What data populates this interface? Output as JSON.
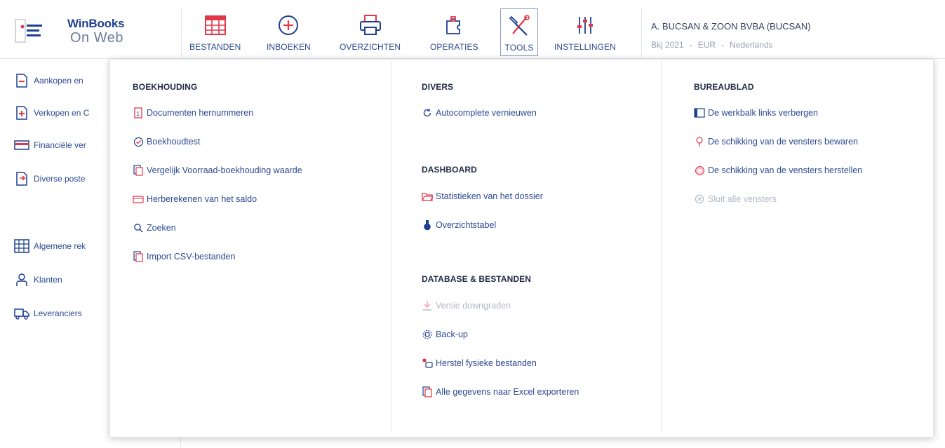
{
  "logo": {
    "name": "WinBooks",
    "sub": "On Web",
    "icon": "winbooks-logo-icon"
  },
  "menu": [
    {
      "label": "BESTANDEN",
      "icon": "grid-table-icon"
    },
    {
      "label": "INBOEKEN",
      "icon": "plus-circle-icon"
    },
    {
      "label": "OVERZICHTEN",
      "icon": "printer-icon"
    },
    {
      "label": "OPERATIES",
      "icon": "puzzle-icon"
    },
    {
      "label": "TOOLS",
      "icon": "tools-icon",
      "active": true
    },
    {
      "label": "INSTELLINGEN",
      "icon": "sliders-icon"
    }
  ],
  "dossier": {
    "name": "A. BUCSAN & ZOON BVBA (BUCSAN)",
    "year": "Bkj 2021",
    "currency": "EUR",
    "language": "Nederlands"
  },
  "sidebar": {
    "items": [
      {
        "label": "Aankopen en",
        "icon": "document-minus-icon"
      },
      {
        "label": "Verkopen en C",
        "icon": "document-plus-icon"
      },
      {
        "label": "Financiële ver",
        "icon": "card-icon"
      },
      {
        "label": "Diverse poste",
        "icon": "document-arrow-icon"
      },
      {
        "label": "Algemene rek",
        "icon": "ledger-icon"
      },
      {
        "label": "Klanten",
        "icon": "users-icon"
      },
      {
        "label": "Leveranciers",
        "icon": "truck-icon"
      }
    ]
  },
  "dropdown": {
    "boekhouding": {
      "title": "BOEKHOUDING",
      "items": [
        {
          "label": "Documenten hernummeren",
          "icon": "renumber-icon"
        },
        {
          "label": "Boekhoudtest",
          "icon": "check-circle-icon"
        },
        {
          "label": "Vergelijk Voorraad-boekhouding waarde",
          "icon": "compare-icon"
        },
        {
          "label": "Herberekenen van het saldo",
          "icon": "recalculate-icon"
        },
        {
          "label": "Zoeken",
          "icon": "search-icon"
        },
        {
          "label": "Import CSV-bestanden",
          "icon": "import-icon"
        }
      ]
    },
    "divers": {
      "title": "DIVERS",
      "items": [
        {
          "label": "Autocomplete vernieuwen",
          "icon": "refresh-icon"
        }
      ]
    },
    "dashboard": {
      "title": "DASHBOARD",
      "items": [
        {
          "label": "Statistieken van het dossier",
          "icon": "folder-open-icon"
        },
        {
          "label": "Overzichtstabel",
          "icon": "flask-icon"
        }
      ]
    },
    "database": {
      "title": "DATABASE & BESTANDEN",
      "items": [
        {
          "label": "Versie downgraden",
          "icon": "download-icon",
          "disabled": true
        },
        {
          "label": "Back-up",
          "icon": "backup-gear-icon"
        },
        {
          "label": "Herstel fysieke bestanden",
          "icon": "repair-icon"
        },
        {
          "label": "Alle gegevens naar Excel exporteren",
          "icon": "excel-export-icon"
        }
      ]
    },
    "bureaublad": {
      "title": "BUREAUBLAD",
      "items": [
        {
          "label": "De werkbalk links verbergen",
          "icon": "sidebar-hide-icon"
        },
        {
          "label": "De schikking van de vensters bewaren",
          "icon": "pin-icon"
        },
        {
          "label": "De schikking van de vensters herstellen",
          "icon": "restore-icon"
        },
        {
          "label": "Sluit alle vensters",
          "icon": "close-circle-icon",
          "disabled": true
        }
      ]
    }
  },
  "colors": {
    "accent": "#2c4a91",
    "danger": "#e2364a",
    "disabled": "#b3b8c4"
  }
}
